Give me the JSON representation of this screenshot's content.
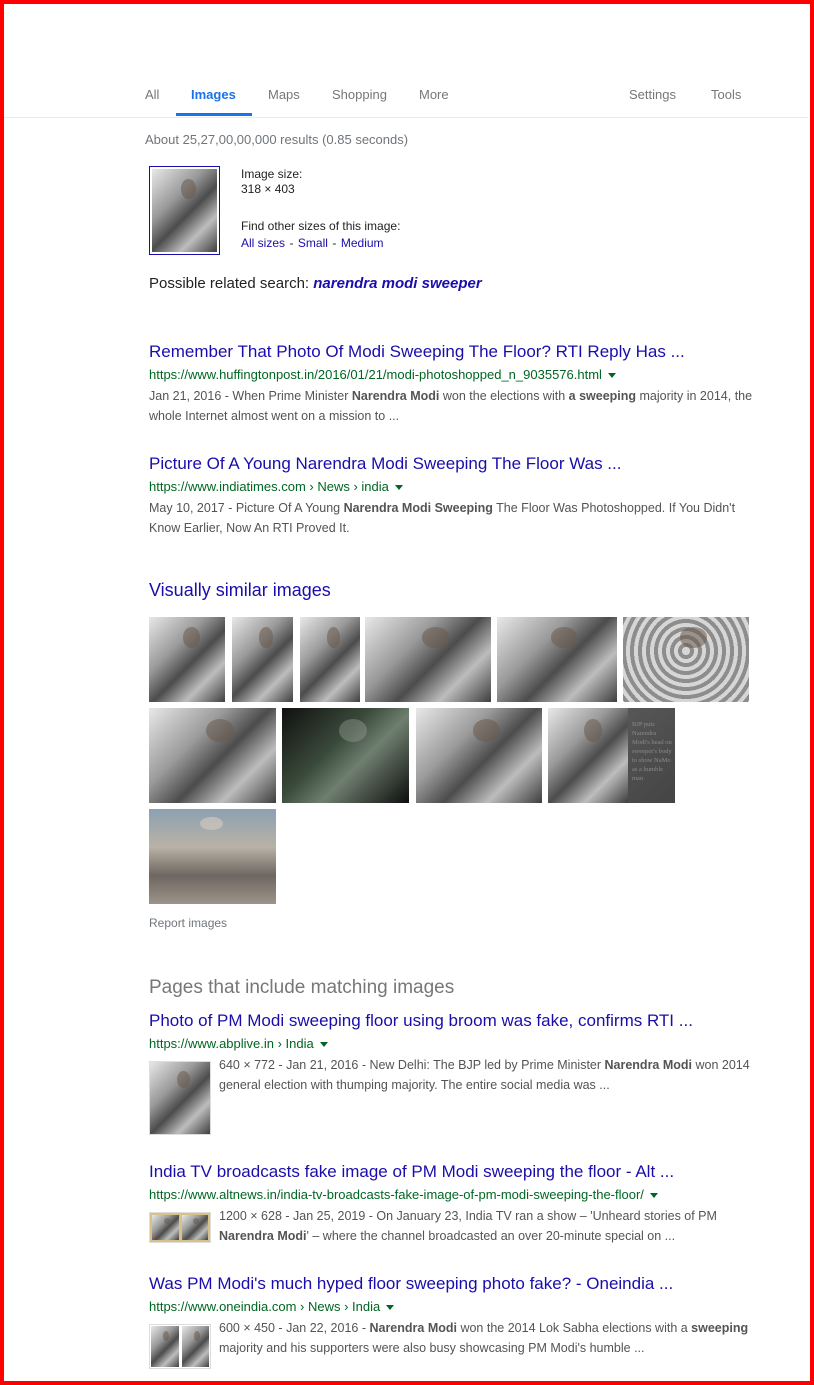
{
  "nav": {
    "tabs": [
      "All",
      "Images",
      "Maps",
      "Shopping",
      "More"
    ],
    "settings": "Settings",
    "tools": "Tools"
  },
  "stats": "About 25,27,00,00,000 results (0.85 seconds)",
  "image_info": {
    "size_label": "Image size:",
    "size_value": "318 × 403",
    "find_label": "Find other sizes of this image:",
    "sizes": [
      "All sizes",
      "Small",
      "Medium"
    ],
    "separator": "-"
  },
  "related": {
    "prefix": "Possible related search:",
    "query": "narendra modi sweeper"
  },
  "results": [
    {
      "title": "Remember That Photo Of Modi Sweeping The Floor? RTI Reply Has ...",
      "url": "https://www.huffingtonpost.in/2016/01/21/modi-photoshopped_n_9035576.html",
      "snippet": "Jan 21, 2016 - When Prime Minister <b>Narendra Modi</b> won the elections with <b>a sweeping</b> majority in 2014, the whole Internet almost went on a mission to ..."
    },
    {
      "title": "Picture Of A Young Narendra Modi Sweeping The Floor Was ...",
      "url": "https://www.indiatimes.com › News › india",
      "snippet": "May 10, 2017 - Picture Of A Young <b>Narendra Modi Sweeping</b> The Floor Was Photoshopped. If You Didn't Know Earlier, Now An RTI Proved It."
    }
  ],
  "similar": {
    "heading": "Visually similar images",
    "report": "Report images",
    "overlay_text": "BJP puts Narendra Modi's head on sweeper's body to show NaMo as a humble man"
  },
  "pages": {
    "heading": "Pages that include matching images",
    "items": [
      {
        "title": "Photo of PM Modi sweeping floor using broom was fake, confirms RTI ...",
        "url": "https://www.abplive.in › India",
        "snippet": "640 × 772 - Jan 21, 2016 - New Delhi: The BJP led by Prime Minister <b>Narendra Modi</b> won 2014 general election with thumping majority. The entire social media was ..."
      },
      {
        "title": "India TV broadcasts fake image of PM Modi sweeping the floor - Alt ...",
        "url": "https://www.altnews.in/india-tv-broadcasts-fake-image-of-pm-modi-sweeping-the-floor/",
        "snippet": "1200 × 628 - Jan 25, 2019 - On January 23, India TV ran a show – 'Unheard stories of PM <b>Narendra Modi</b>' – where the channel broadcasted an over 20-minute special on ..."
      },
      {
        "title": "Was PM Modi's much hyped floor sweeping photo fake? - Oneindia ...",
        "url": "https://www.oneindia.com › News › India",
        "snippet": "600 × 450 - Jan 22, 2016 - <b>Narendra Modi</b> won the 2014 Lok Sabha elections with a <b>sweeping</b> majority and his supporters were also busy showcasing PM Modi's humble ..."
      }
    ]
  }
}
